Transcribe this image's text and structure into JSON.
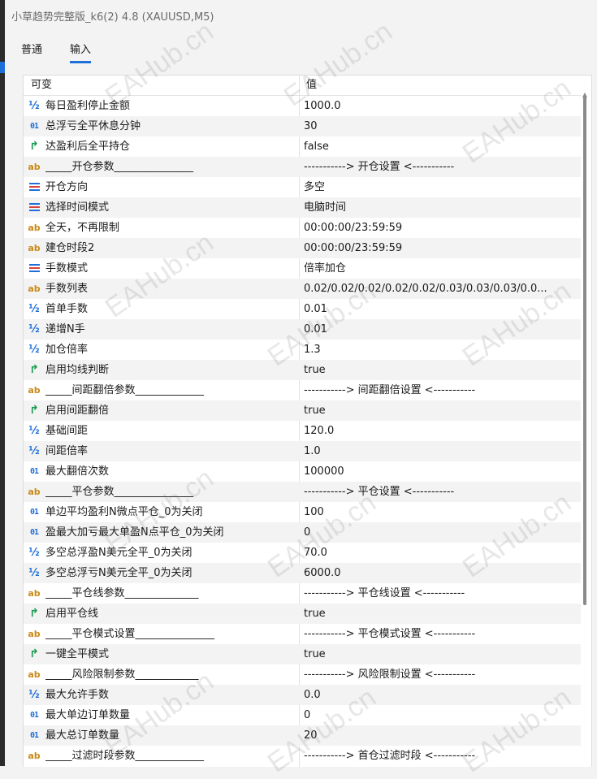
{
  "window": {
    "title": "小草趋势完整版_k6(2) 4.8 (XAUUSD,M5)"
  },
  "tabs": [
    {
      "label": "普通",
      "active": false
    },
    {
      "label": "输入",
      "active": true
    }
  ],
  "table": {
    "headers": {
      "variable": "可变",
      "value": "值"
    },
    "rows": [
      {
        "type": "double",
        "name": "每日盈利停止金额",
        "value": "1000.0"
      },
      {
        "type": "int",
        "name": "总浮亏全平休息分钟",
        "value": "30"
      },
      {
        "type": "bool",
        "name": "达盈利后全平持仓",
        "value": "false"
      },
      {
        "type": "string",
        "name": "_____开仓参数_______________",
        "value": "-----------> 开仓设置 <-----------"
      },
      {
        "type": "enum",
        "name": "开仓方向",
        "value": "多空"
      },
      {
        "type": "enum",
        "name": "选择时间模式",
        "value": "电脑时间"
      },
      {
        "type": "string",
        "name": "全天，不再限制",
        "value": "00:00:00/23:59:59"
      },
      {
        "type": "string",
        "name": "建仓时段2",
        "value": "00:00:00/23:59:59"
      },
      {
        "type": "enum",
        "name": "手数模式",
        "value": "倍率加仓"
      },
      {
        "type": "string",
        "name": "手数列表",
        "value": "0.02/0.02/0.02/0.02/0.02/0.03/0.03/0.03/0.0..."
      },
      {
        "type": "double",
        "name": "首单手数",
        "value": "0.01"
      },
      {
        "type": "double",
        "name": "递增N手",
        "value": "0.01"
      },
      {
        "type": "double",
        "name": "加仓倍率",
        "value": "1.3"
      },
      {
        "type": "bool",
        "name": "启用均线判断",
        "value": "true"
      },
      {
        "type": "string",
        "name": "_____间距翻倍参数_____________",
        "value": "-----------> 间距翻倍设置 <-----------"
      },
      {
        "type": "bool",
        "name": "启用间距翻倍",
        "value": "true"
      },
      {
        "type": "double",
        "name": "基础间距",
        "value": "120.0"
      },
      {
        "type": "double",
        "name": "间距倍率",
        "value": "1.0"
      },
      {
        "type": "int",
        "name": "最大翻倍次数",
        "value": "100000"
      },
      {
        "type": "string",
        "name": "_____平仓参数_______________",
        "value": "-----------> 平仓设置 <-----------"
      },
      {
        "type": "int",
        "name": "单边平均盈利N微点平仓_0为关闭",
        "value": "100"
      },
      {
        "type": "int",
        "name": "盈最大加亏最大单盈N点平仓_0为关闭",
        "value": "0"
      },
      {
        "type": "double",
        "name": "多空总浮盈N美元全平_0为关闭",
        "value": "70.0"
      },
      {
        "type": "double",
        "name": "多空总浮亏N美元全平_0为关闭",
        "value": "6000.0"
      },
      {
        "type": "string",
        "name": "_____平仓线参数______________",
        "value": "-----------> 平仓线设置 <-----------"
      },
      {
        "type": "bool",
        "name": "启用平仓线",
        "value": "true"
      },
      {
        "type": "string",
        "name": "_____平仓模式设置_______________",
        "value": "-----------> 平仓模式设置 <-----------"
      },
      {
        "type": "bool",
        "name": "一键全平模式",
        "value": "true"
      },
      {
        "type": "string",
        "name": "_____风险限制参数____________",
        "value": "-----------> 风险限制设置 <-----------"
      },
      {
        "type": "double",
        "name": "最大允许手数",
        "value": "0.0"
      },
      {
        "type": "int",
        "name": "最大单边订单数量",
        "value": "0"
      },
      {
        "type": "int",
        "name": "最大总订单数量",
        "value": "20"
      },
      {
        "type": "string",
        "name": "_____过滤时段参数_____________",
        "value": "-----------> 首仓过滤时段 <-----------"
      }
    ]
  },
  "icons": {
    "double": "half-icon",
    "int": "integer-01-icon",
    "bool": "bool-arrow-icon",
    "string": "ab-string-icon",
    "enum": "enum-list-icon"
  },
  "colors": {
    "accent": "#1e6fd9",
    "bool_icon": "#1a9a50",
    "string_icon": "#c98a16",
    "alt_row": "#f3f3f3"
  },
  "watermark": "EAHub.cn"
}
